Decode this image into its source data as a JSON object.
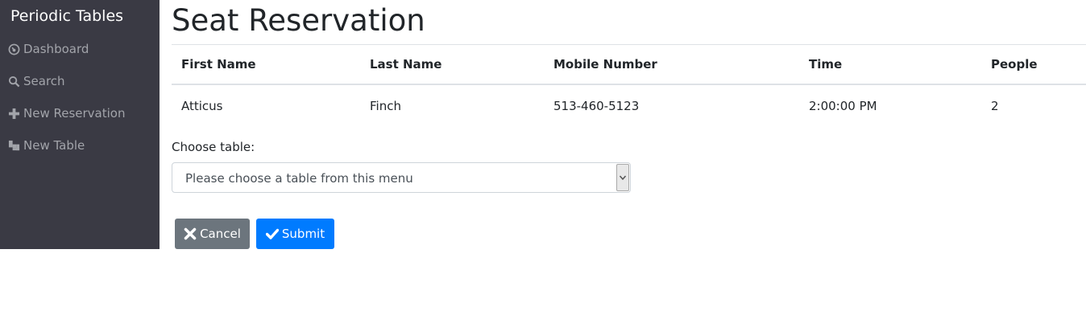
{
  "sidebar": {
    "brand": "Periodic Tables",
    "items": [
      {
        "label": "Dashboard",
        "icon": "dashboard-icon"
      },
      {
        "label": "Search",
        "icon": "search-icon"
      },
      {
        "label": "New Reservation",
        "icon": "plus-icon"
      },
      {
        "label": "New Table",
        "icon": "new-table-icon"
      }
    ]
  },
  "main": {
    "title": "Seat Reservation",
    "table": {
      "headers": [
        "First Name",
        "Last Name",
        "Mobile Number",
        "Time",
        "People"
      ],
      "rows": [
        [
          "Atticus",
          "Finch",
          "513-460-5123",
          "2:00:00 PM",
          "2"
        ]
      ]
    },
    "form": {
      "label": "Choose table:",
      "select_value": "Please choose a table from this menu"
    },
    "buttons": {
      "cancel": "Cancel",
      "submit": "Submit"
    }
  },
  "colors": {
    "sidebar_bg": "#3a3a44",
    "nav_text": "#a2a4aa",
    "cancel_bg": "#6c757d",
    "submit_bg": "#007bff"
  }
}
